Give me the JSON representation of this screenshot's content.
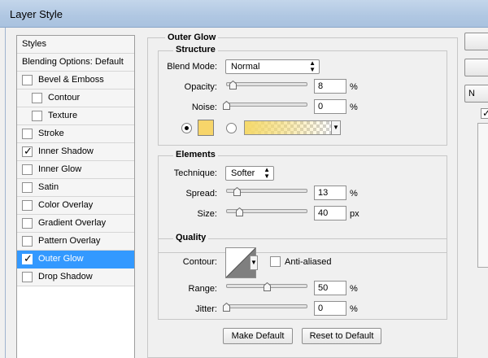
{
  "window": {
    "title": "Layer Style"
  },
  "styles_list": {
    "header": "Styles",
    "blending_options": "Blending Options: Default",
    "items": [
      {
        "label": "Bevel & Emboss",
        "checked": false,
        "indent": false
      },
      {
        "label": "Contour",
        "checked": false,
        "indent": true
      },
      {
        "label": "Texture",
        "checked": false,
        "indent": true
      },
      {
        "label": "Stroke",
        "checked": false,
        "indent": false
      },
      {
        "label": "Inner Shadow",
        "checked": true,
        "indent": false
      },
      {
        "label": "Inner Glow",
        "checked": false,
        "indent": false
      },
      {
        "label": "Satin",
        "checked": false,
        "indent": false
      },
      {
        "label": "Color Overlay",
        "checked": false,
        "indent": false
      },
      {
        "label": "Gradient Overlay",
        "checked": false,
        "indent": false
      },
      {
        "label": "Pattern Overlay",
        "checked": false,
        "indent": false
      },
      {
        "label": "Outer Glow",
        "checked": true,
        "indent": false,
        "selected": true
      },
      {
        "label": "Drop Shadow",
        "checked": false,
        "indent": false
      }
    ],
    "checkmark": "✓"
  },
  "outer_glow": {
    "title": "Outer Glow",
    "structure": {
      "title": "Structure",
      "blend_mode": {
        "label": "Blend Mode:",
        "value": "Normal"
      },
      "opacity": {
        "label": "Opacity:",
        "value": "8",
        "unit": "%",
        "level_percent": 8
      },
      "noise": {
        "label": "Noise:",
        "value": "0",
        "unit": "%",
        "level_percent": 0
      },
      "color_mode": "solid",
      "swatch_color": "#f7d56a"
    },
    "elements": {
      "title": "Elements",
      "technique": {
        "label": "Technique:",
        "value": "Softer"
      },
      "spread": {
        "label": "Spread:",
        "value": "13",
        "unit": "%",
        "level_percent": 13
      },
      "size": {
        "label": "Size:",
        "value": "40",
        "unit": "px",
        "level_percent": 16
      }
    },
    "quality": {
      "title": "Quality",
      "contour": {
        "label": "Contour:"
      },
      "anti_aliased": {
        "label": "Anti-aliased",
        "checked": false
      },
      "range": {
        "label": "Range:",
        "value": "50",
        "unit": "%",
        "level_percent": 50
      },
      "jitter": {
        "label": "Jitter:",
        "value": "0",
        "unit": "%",
        "level_percent": 0
      }
    },
    "buttons": {
      "make_default": "Make Default",
      "reset_default": "Reset to Default"
    }
  },
  "right_panel": {
    "button_3_partial": "N",
    "checkbox_checked": true
  },
  "colors": {
    "selected_row": "#3399ff",
    "titlebar": "#b8cce4"
  }
}
